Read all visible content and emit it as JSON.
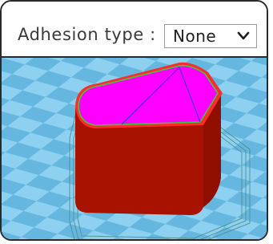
{
  "adhesion": {
    "label": "Adhesion type :",
    "selected": "None"
  },
  "colors": {
    "floor_light": "#8ed0f0",
    "floor_dark": "#66b7df",
    "model_side": "#a81200",
    "model_top": "#ff00ff",
    "outline_red": "#ff2b2b",
    "outline_green": "#3cc83c",
    "infill_blue": "#3a3acf"
  },
  "icons": {
    "dropdown": "chevron-down-icon"
  }
}
